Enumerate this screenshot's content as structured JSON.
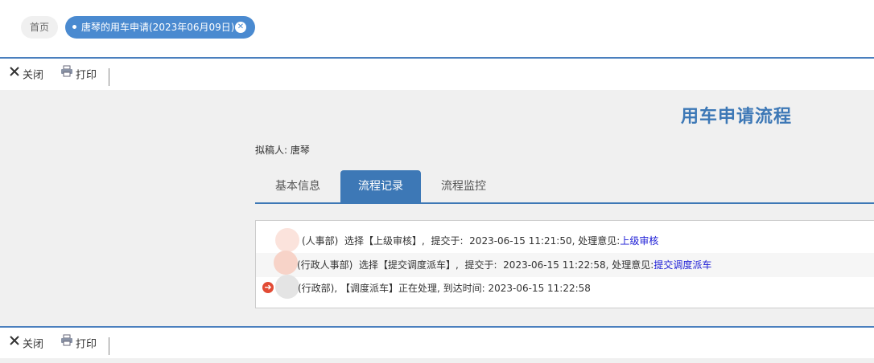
{
  "tabs": {
    "home_label": "首页",
    "active_label": "唐琴的用车申请(2023年06月09日)"
  },
  "toolbar": {
    "close_label": "关闭",
    "print_label": "打印"
  },
  "page": {
    "title": "用车申请流程",
    "drafter_label": "拟稿人:",
    "drafter_name": "唐琴"
  },
  "process_tabs": [
    {
      "label": "基本信息",
      "selected": false
    },
    {
      "label": "流程记录",
      "selected": true
    },
    {
      "label": "流程监控",
      "selected": false
    }
  ],
  "records": [
    {
      "dept": "(人事部)",
      "action": "选择【上级审核】,",
      "submitted_label": "提交于:",
      "time": "2023-06-15 11:21:50,",
      "opinion_label": "处理意见:",
      "opinion": "上级审核"
    },
    {
      "dept": "(行政人事部)",
      "action": "选择【提交调度派车】,",
      "submitted_label": "提交于:",
      "time": "2023-06-15 11:22:58,",
      "opinion_label": "处理意见:",
      "opinion": "提交调度派车"
    },
    {
      "text": "(行政部), 【调度派车】正在处理, 到达时间: 2023-06-15 11:22:58"
    }
  ],
  "colors": {
    "accent": "#3d78b6",
    "tab_active": "#4a8ad0",
    "link": "#1c1cd6",
    "current_marker": "#e24b35"
  }
}
